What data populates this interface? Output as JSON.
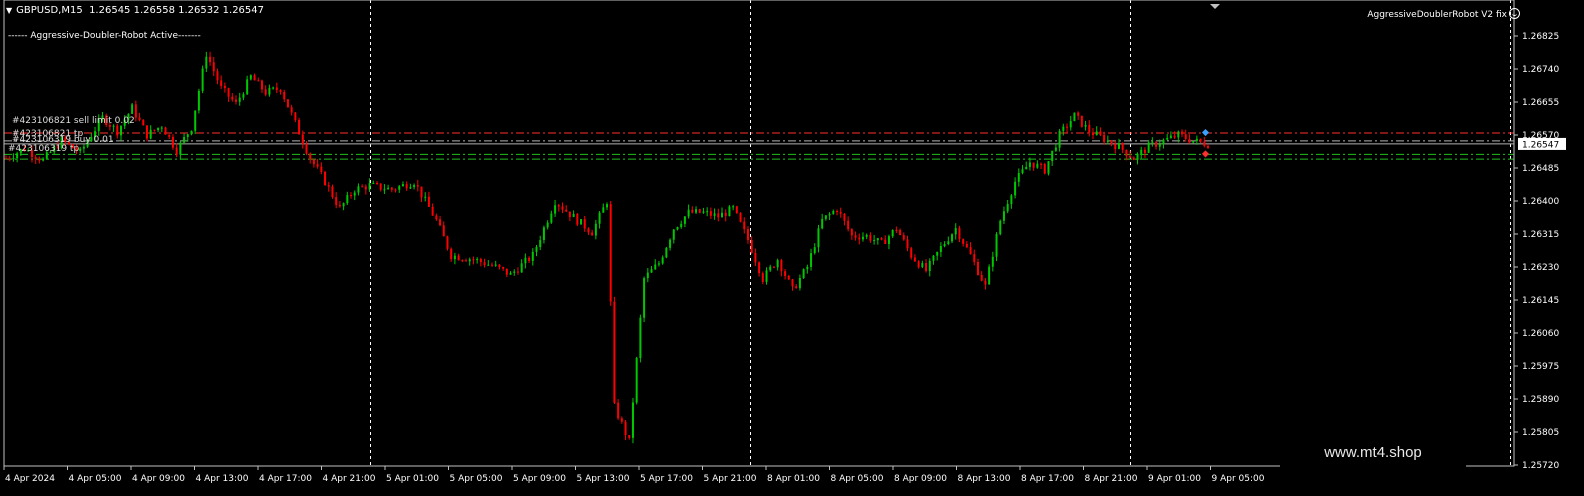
{
  "header": {
    "symbol": "GBPUSD,M15",
    "quote": "1.26545 1.26558 1.26532 1.26547"
  },
  "status_text": "------ Aggressive-Doubler-Robot Active-------",
  "expert_label": "AggressiveDoublerRobot V2 fix",
  "watermark": "www.mt4.shop",
  "order_labels": {
    "sell_limit": "#423106821 sell limit 0.02",
    "tp1": "#423106821 tp",
    "buy": "#423106319 buy 0.01",
    "tp2": "#423106319 tp"
  },
  "colors": {
    "bull": "#00c800",
    "bear": "#ff0000",
    "grid": "#ffffff",
    "axis": "#c0c0c0",
    "sell_line": "#ff3030",
    "buy_line": "#20c020",
    "price_line": "#b0b0b0",
    "price_tag_bg": "#ffffff",
    "price_tag_fg": "#000000"
  },
  "chart_data": {
    "type": "candlestick",
    "symbol": "GBPUSD",
    "timeframe": "M15",
    "current_price": 1.26547,
    "ylim": [
      1.2568,
      1.269
    ],
    "y_ticks": [
      1.26825,
      1.2674,
      1.26655,
      1.2657,
      1.26485,
      1.264,
      1.26315,
      1.2623,
      1.26145,
      1.2606,
      1.25975,
      1.2589,
      1.25805,
      1.2572
    ],
    "x_ticks": [
      "4 Apr 2024",
      "4 Apr 05:00",
      "4 Apr 09:00",
      "4 Apr 13:00",
      "4 Apr 17:00",
      "4 Apr 21:00",
      "5 Apr 01:00",
      "5 Apr 05:00",
      "5 Apr 09:00",
      "5 Apr 13:00",
      "5 Apr 17:00",
      "5 Apr 21:00",
      "8 Apr 01:00",
      "8 Apr 05:00",
      "8 Apr 09:00",
      "8 Apr 13:00",
      "8 Apr 17:00",
      "8 Apr 21:00",
      "9 Apr 01:00",
      "9 Apr 05:00"
    ],
    "day_separators": [
      "5 Apr",
      "8 Apr",
      "9 Apr"
    ],
    "levels": {
      "sell_limit": 1.26575,
      "tp_upper": 1.26555,
      "buy": 1.2652,
      "tp_lower": 1.26508
    },
    "path": [
      [
        0,
        1.2651
      ],
      [
        5,
        1.26535
      ],
      [
        10,
        1.26505
      ],
      [
        15,
        1.26555
      ],
      [
        20,
        1.26525
      ],
      [
        26,
        1.26615
      ],
      [
        30,
        1.2658
      ],
      [
        34,
        1.2664
      ],
      [
        38,
        1.2657
      ],
      [
        42,
        1.26595
      ],
      [
        46,
        1.2653
      ],
      [
        50,
        1.2659
      ],
      [
        54,
        1.2678
      ],
      [
        58,
        1.2669
      ],
      [
        62,
        1.2665
      ],
      [
        66,
        1.2672
      ],
      [
        70,
        1.2668
      ],
      [
        74,
        1.2669
      ],
      [
        78,
        1.266
      ],
      [
        82,
        1.2651
      ],
      [
        86,
        1.2645
      ],
      [
        90,
        1.2638
      ],
      [
        94,
        1.2643
      ],
      [
        98,
        1.2644
      ],
      [
        104,
        1.2643
      ],
      [
        110,
        1.2645
      ],
      [
        116,
        1.2635
      ],
      [
        120,
        1.2626
      ],
      [
        126,
        1.2625
      ],
      [
        132,
        1.2623
      ],
      [
        136,
        1.2621
      ],
      [
        142,
        1.2626
      ],
      [
        148,
        1.264
      ],
      [
        154,
        1.2635
      ],
      [
        158,
        1.2632
      ],
      [
        162,
        1.264
      ],
      [
        164,
        1.2587
      ],
      [
        168,
        1.2578
      ],
      [
        172,
        1.262
      ],
      [
        176,
        1.2624
      ],
      [
        180,
        1.2633
      ],
      [
        184,
        1.2637
      ],
      [
        188,
        1.2637
      ],
      [
        192,
        1.2636
      ],
      [
        196,
        1.2638
      ],
      [
        200,
        1.263
      ],
      [
        204,
        1.262
      ],
      [
        208,
        1.2625
      ],
      [
        212,
        1.2617
      ],
      [
        216,
        1.2623
      ],
      [
        220,
        1.2635
      ],
      [
        224,
        1.2638
      ],
      [
        228,
        1.2631
      ],
      [
        232,
        1.2631
      ],
      [
        236,
        1.2629
      ],
      [
        240,
        1.2633
      ],
      [
        244,
        1.2626
      ],
      [
        248,
        1.2622
      ],
      [
        252,
        1.2628
      ],
      [
        256,
        1.2633
      ],
      [
        260,
        1.2626
      ],
      [
        264,
        1.2618
      ],
      [
        268,
        1.2635
      ],
      [
        272,
        1.2645
      ],
      [
        276,
        1.265
      ],
      [
        280,
        1.2648
      ],
      [
        284,
        1.2657
      ],
      [
        288,
        1.2662
      ],
      [
        292,
        1.2658
      ],
      [
        296,
        1.2656
      ],
      [
        300,
        1.2654
      ],
      [
        304,
        1.2651
      ],
      [
        308,
        1.2654
      ],
      [
        312,
        1.26555
      ],
      [
        316,
        1.2657
      ],
      [
        320,
        1.26555
      ],
      [
        324,
        1.26547
      ]
    ]
  }
}
